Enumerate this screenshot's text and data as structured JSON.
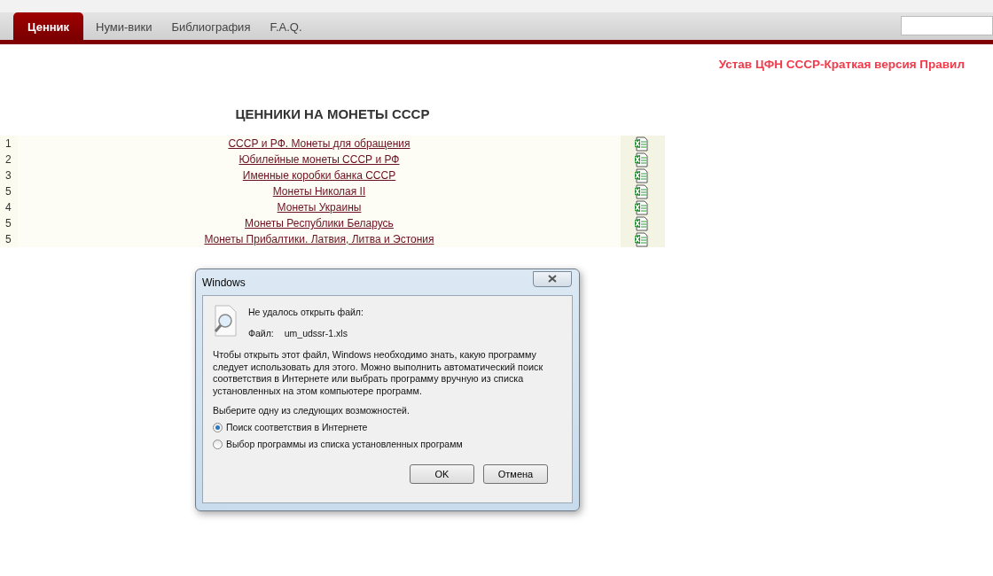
{
  "nav": {
    "tabs": [
      {
        "label": "Ценник",
        "selected": true
      },
      {
        "label": "Нуми-вики",
        "selected": false
      },
      {
        "label": "Библиография",
        "selected": false
      },
      {
        "label": "F.A.Q.",
        "selected": false
      }
    ]
  },
  "top_link": "Устав ЦФН СССР-Краткая версия Правил",
  "heading": "ЦЕННИКИ НА МОНЕТЫ СССР",
  "price_lists": [
    {
      "number": "1",
      "title": "СССР и РФ. Монеты для обращения"
    },
    {
      "number": "2",
      "title": "Юбилейные монеты СССР и РФ"
    },
    {
      "number": "3",
      "title": "Именные коробки банка СССР"
    },
    {
      "number": "5",
      "title": "Монеты Николая II"
    },
    {
      "number": "4",
      "title": "Монеты Украины"
    },
    {
      "number": "5",
      "title": "Монеты Республики Беларусь"
    },
    {
      "number": "5",
      "title": "Монеты Прибалтики. Латвия, Литва и Эстония"
    }
  ],
  "dialog": {
    "title": "Windows",
    "message": "Не удалось открыть файл:",
    "file_label": "Файл:",
    "file_name": "um_udssr-1.xls",
    "description": "Чтобы открыть этот файл, Windows необходимо знать, какую программу следует использовать для этого. Можно выполнить автоматический поиск соответствия в Интернете или выбрать программу вручную из списка установленных на этом компьютере программ.",
    "prompt": "Выберите одну из следующих возможностей.",
    "options": [
      {
        "label": "Поиск соответствия в Интернете",
        "selected": true
      },
      {
        "label": "Выбор программы из списка установленных программ",
        "selected": false
      }
    ],
    "buttons": [
      "OK",
      "Отмена"
    ]
  }
}
